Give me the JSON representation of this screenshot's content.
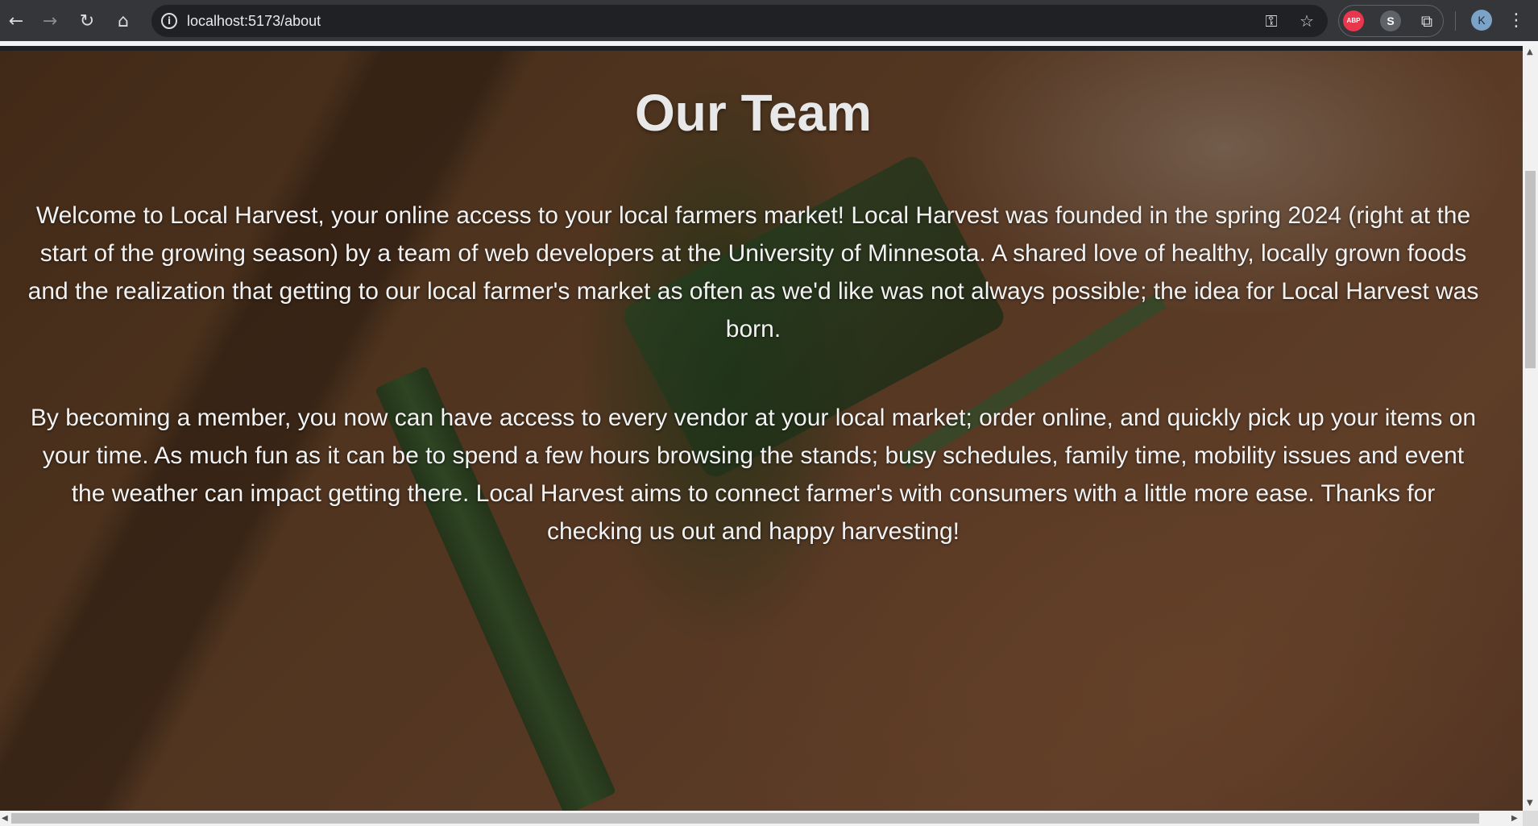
{
  "browser": {
    "url": "localhost:5173/about",
    "nav": {
      "back_icon": "←",
      "forward_icon": "→",
      "reload_icon": "↻",
      "home_icon": "⌂"
    },
    "extensions": {
      "abp_label": "ABP",
      "s_label": "S"
    },
    "profile_initial": "K"
  },
  "page": {
    "title": "Our Team",
    "paragraph1": "Welcome to Local Harvest, your online access to your local farmers market! Local Harvest was founded in the spring 2024 (right at the start of the growing season) by a team of web developers at the University of Minnesota. A shared love of healthy, locally grown foods and the realization that getting to our local farmer's market as often as we'd like was not always possible; the idea for Local Harvest was born.",
    "paragraph2": "By becoming a member, you now can have access to every vendor at your local market; order online, and quickly pick up your items on your time. As much fun as it can be to spend a few hours browsing the stands; busy schedules, family time, mobility issues and event the weather can impact getting there. Local Harvest aims to connect farmer's with consumers with a little more ease. Thanks for checking us out and happy harvesting!"
  },
  "colors": {
    "toolbar": "#35363a",
    "omnibox": "#202124",
    "abp_red": "#e8364c",
    "avatar_blue": "#7ba3c8"
  },
  "icons": [
    "back-icon",
    "forward-icon",
    "reload-icon",
    "home-icon",
    "info-icon",
    "password-key-icon",
    "bookmark-star-icon",
    "adblock-icon",
    "s-extension-icon",
    "puzzle-icon",
    "kebab-menu-icon"
  ]
}
